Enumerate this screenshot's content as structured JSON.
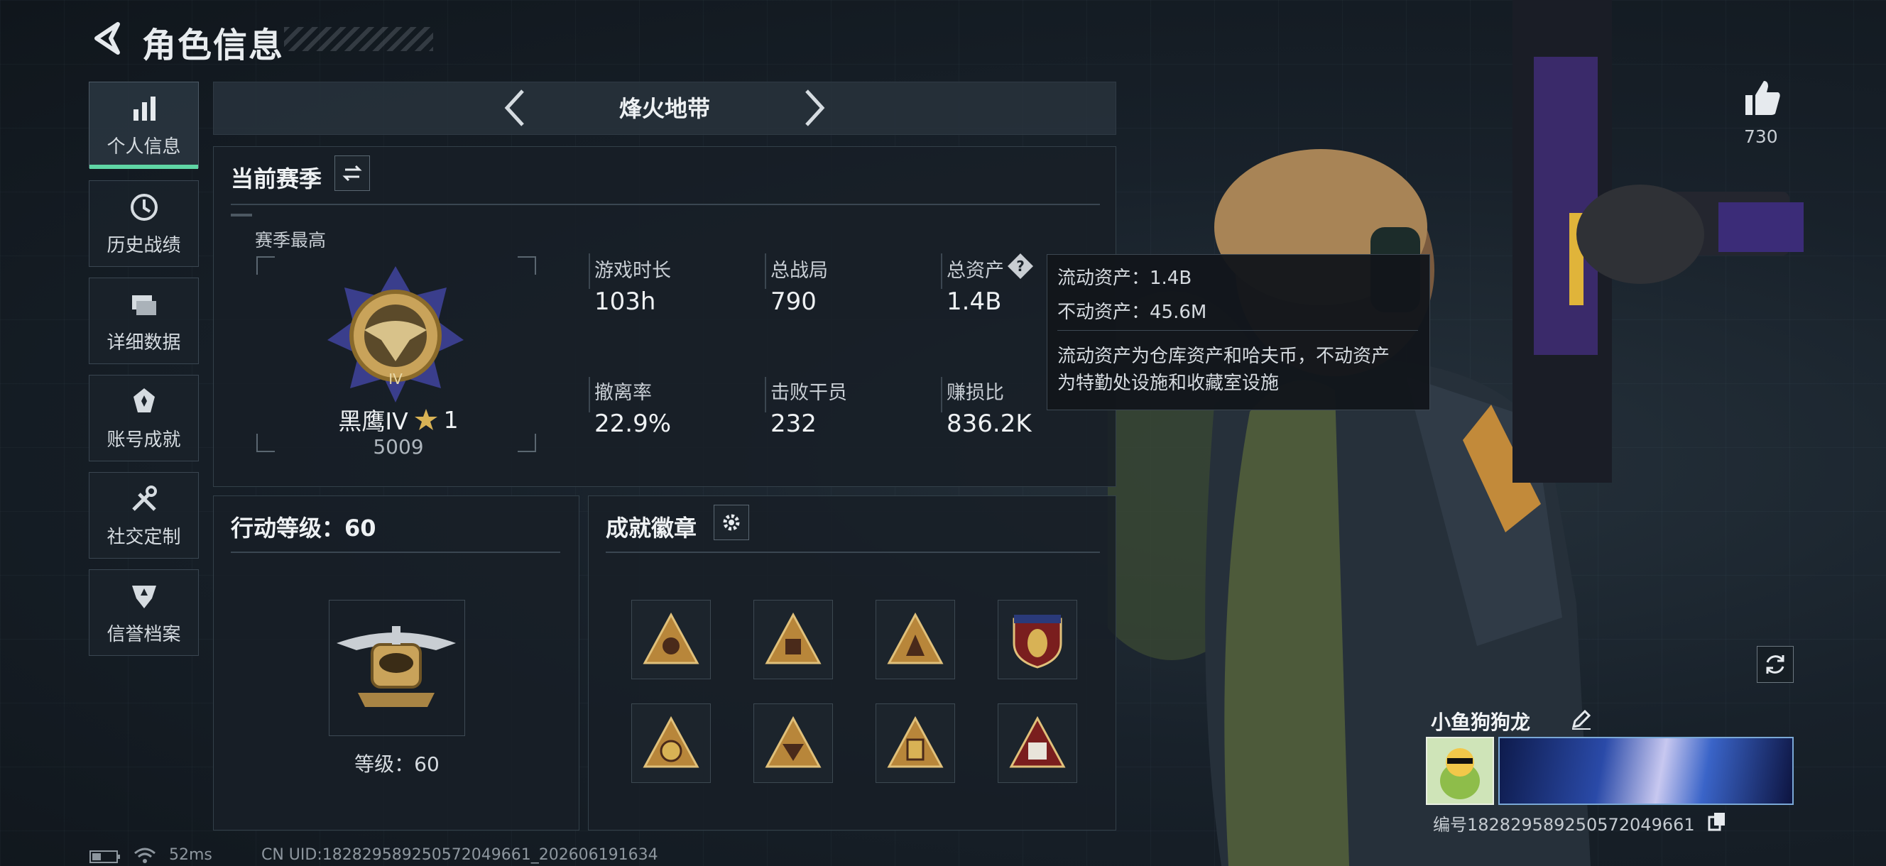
{
  "header": {
    "title": "角色信息"
  },
  "nav": {
    "items": [
      {
        "label": "个人信息",
        "icon": "bar-chart-icon",
        "active": true
      },
      {
        "label": "历史战绩",
        "icon": "clock-history-icon"
      },
      {
        "label": "详细数据",
        "icon": "folder-stack-icon"
      },
      {
        "label": "账号成就",
        "icon": "achievement-medal-icon"
      },
      {
        "label": "社交定制",
        "icon": "tools-customize-icon"
      },
      {
        "label": "信誉档案",
        "icon": "reputation-shield-icon"
      }
    ]
  },
  "mode": {
    "title": "烽火地带"
  },
  "season": {
    "title": "当前赛季",
    "best_label": "赛季最高",
    "rank_name": "黑鹰IV",
    "rank_stars": "1",
    "rank_score": "5009",
    "stats": [
      {
        "label": "游戏时长",
        "value": "103h"
      },
      {
        "label": "总战局",
        "value": "790"
      },
      {
        "label": "总资产",
        "value": "1.4B"
      },
      {
        "label": "撤离率",
        "value": "22.9%"
      },
      {
        "label": "击败干员",
        "value": "232"
      },
      {
        "label": "赚损比",
        "value": "836.2K"
      }
    ]
  },
  "tooltip": {
    "liquid": "流动资产：1.4B",
    "fixed": "不动资产：45.6M",
    "desc_line1": "流动资产为仓库资产和哈夫币，不动资产",
    "desc_line2": "为特勤处设施和收藏室设施"
  },
  "action_level": {
    "title": "行动等级：60",
    "level_text": "等级：60"
  },
  "badges": {
    "title": "成就徽章",
    "items": [
      "badge-1",
      "badge-2",
      "badge-3",
      "badge-4",
      "badge-5",
      "badge-6",
      "badge-7",
      "badge-8"
    ]
  },
  "social": {
    "likes": "730"
  },
  "player": {
    "name": "小鱼狗狗龙",
    "id_text": "编号1828295892505720496​61"
  },
  "footer": {
    "ping": "52ms",
    "uid": "CN UID:18282958925057204966​1_202606191634"
  },
  "colors": {
    "accent": "#5fd6a5",
    "gold": "#c9a35a"
  }
}
